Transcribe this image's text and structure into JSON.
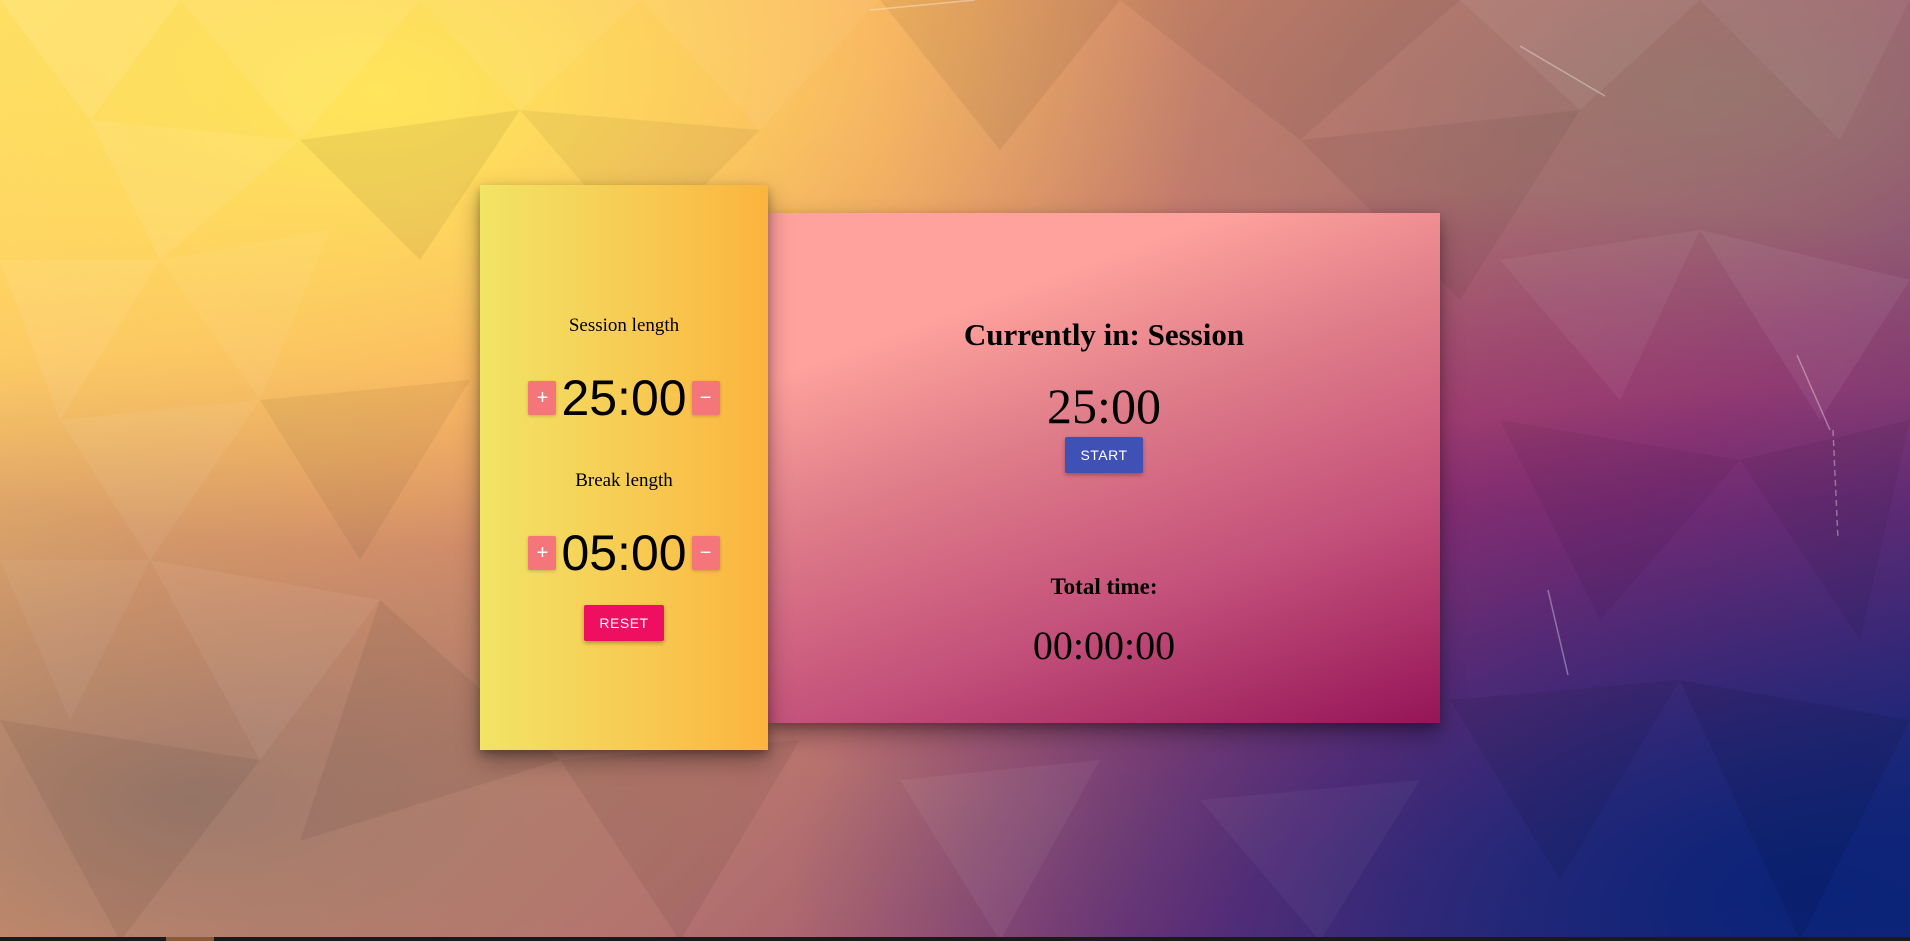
{
  "colors": {
    "settings_panel_gradient": [
      "#f1e466",
      "#fbb43e"
    ],
    "timer_panel_gradient": [
      "#ffa19c",
      "#951558"
    ],
    "adjust_button": "#f4767b",
    "reset_button": "#ee0f61",
    "start_button": "#3f51b5"
  },
  "settings": {
    "session": {
      "label": "Session length",
      "value": "25:00",
      "increment_label": "+",
      "decrement_label": "−",
      "increment_icon": "plus-icon",
      "decrement_icon": "minus-icon"
    },
    "break": {
      "label": "Break length",
      "value": "05:00",
      "increment_label": "+",
      "decrement_label": "−",
      "increment_icon": "plus-icon",
      "decrement_icon": "minus-icon"
    },
    "reset_label": "RESET"
  },
  "timer": {
    "heading": "Currently in: Session",
    "countdown": "25:00",
    "start_label": "START",
    "total_label": "Total time:",
    "total_value": "00:00:00"
  }
}
